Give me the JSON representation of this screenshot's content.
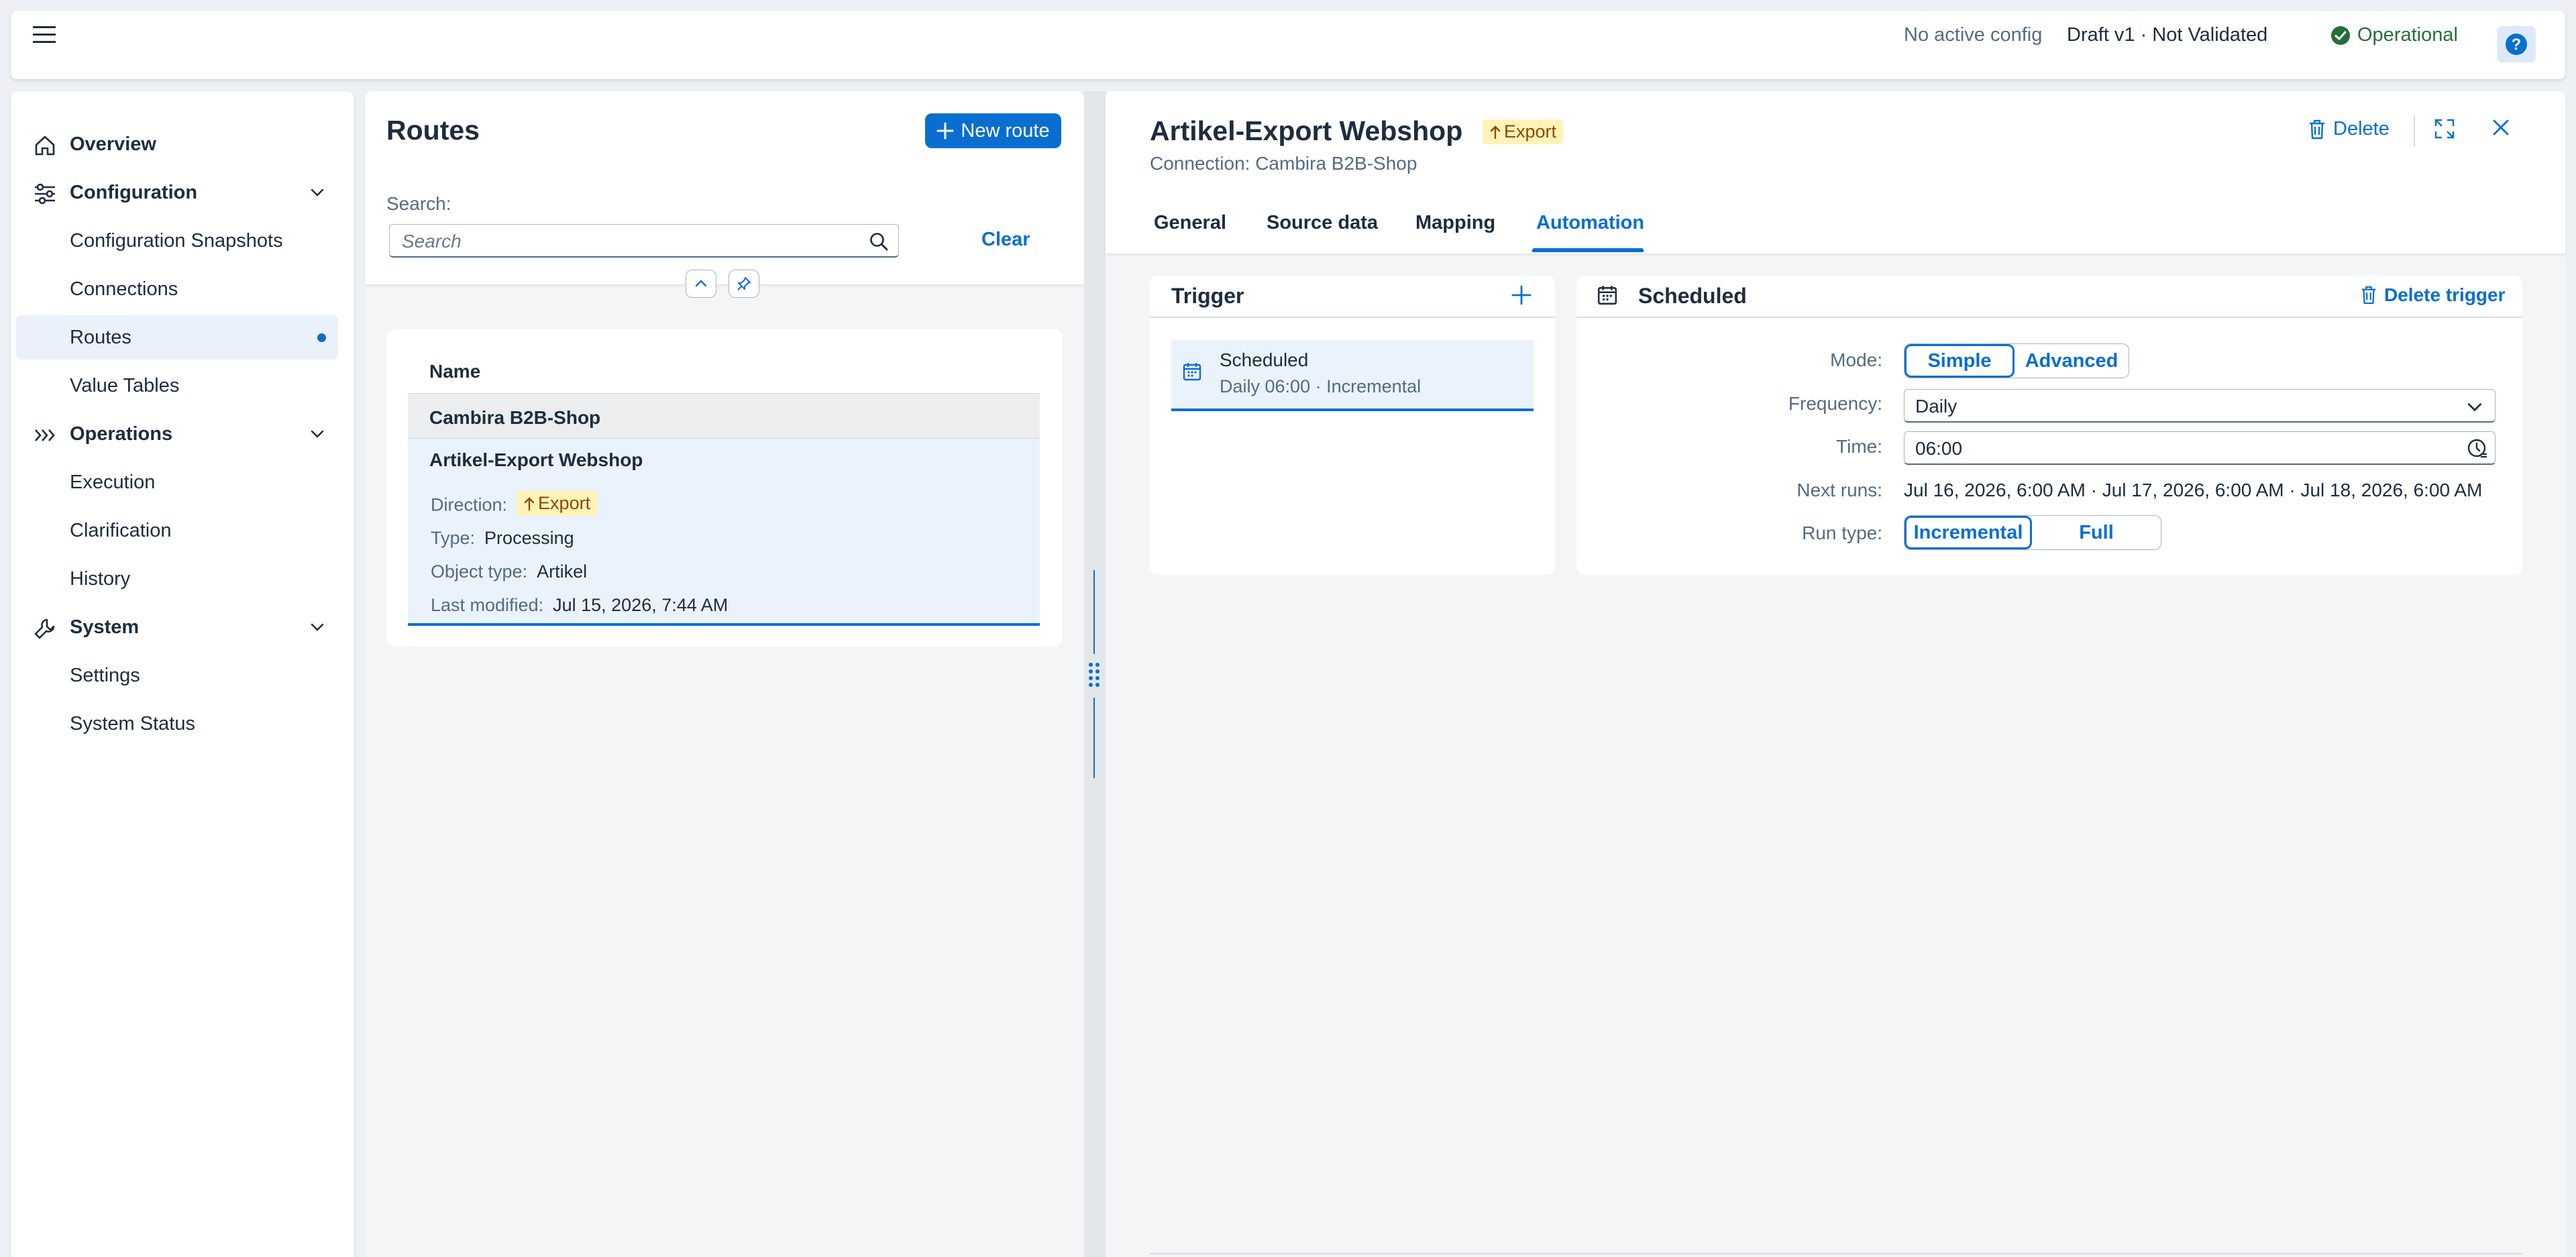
{
  "shell": {
    "no_config": "No active config",
    "draft": "Draft v1 · Not Validated",
    "status": "Operational",
    "help": "?"
  },
  "sidebar": {
    "items": [
      {
        "label": "Overview",
        "icon": "home-icon",
        "type": "top"
      },
      {
        "label": "Configuration",
        "icon": "sliders-icon",
        "type": "group"
      },
      {
        "label": "Configuration Snapshots",
        "type": "sub"
      },
      {
        "label": "Connections",
        "type": "sub"
      },
      {
        "label": "Routes",
        "type": "sub",
        "selected": true
      },
      {
        "label": "Value Tables",
        "type": "sub"
      },
      {
        "label": "Operations",
        "icon": "chevrons-right-icon",
        "type": "group"
      },
      {
        "label": "Execution",
        "type": "sub"
      },
      {
        "label": "Clarification",
        "type": "sub"
      },
      {
        "label": "History",
        "type": "sub"
      },
      {
        "label": "System",
        "icon": "wrench-icon",
        "type": "group"
      },
      {
        "label": "Settings",
        "type": "sub"
      },
      {
        "label": "System Status",
        "type": "sub"
      }
    ]
  },
  "routes": {
    "title": "Routes",
    "new_route": "New route",
    "search_label": "Search:",
    "search_placeholder": "Search",
    "search_value": "",
    "clear": "Clear",
    "column_name": "Name",
    "group": "Cambira B2B-Shop",
    "item": {
      "title": "Artikel-Export Webshop",
      "direction_label": "Direction:",
      "direction_value": "Export",
      "type_label": "Type:",
      "type_value": "Processing",
      "object_label": "Object type:",
      "object_value": "Artikel",
      "modified_label": "Last modified:",
      "modified_value": "Jul 15, 2026, 7:44 AM"
    }
  },
  "detail": {
    "title": "Artikel-Export Webshop",
    "badge": "Export",
    "subtitle": "Connection: Cambira B2B-Shop",
    "delete": "Delete",
    "tabs": [
      {
        "label": "General"
      },
      {
        "label": "Source data"
      },
      {
        "label": "Mapping"
      },
      {
        "label": "Automation",
        "active": true
      }
    ]
  },
  "trigger": {
    "title": "Trigger",
    "item_name": "Scheduled",
    "item_desc": "Daily 06:00 · Incremental"
  },
  "scheduled": {
    "title": "Scheduled",
    "delete_trigger": "Delete trigger",
    "mode_label": "Mode:",
    "mode_options": [
      "Simple",
      "Advanced"
    ],
    "mode_selected": "Simple",
    "frequency_label": "Frequency:",
    "frequency_value": "Daily",
    "time_label": "Time:",
    "time_value": "06:00",
    "next_runs_label": "Next runs:",
    "next_runs_value": "Jul 16, 2026, 6:00 AM · Jul 17, 2026, 6:00 AM · Jul 18, 2026, 6:00 AM",
    "run_type_label": "Run type:",
    "run_type_options": [
      "Incremental",
      "Full"
    ],
    "run_type_selected": "Incremental"
  },
  "colors": {
    "accent": "#0a6ed1",
    "success": "#256f3a",
    "badge_bg": "#fff3b8",
    "badge_fg": "#8a4a00"
  }
}
